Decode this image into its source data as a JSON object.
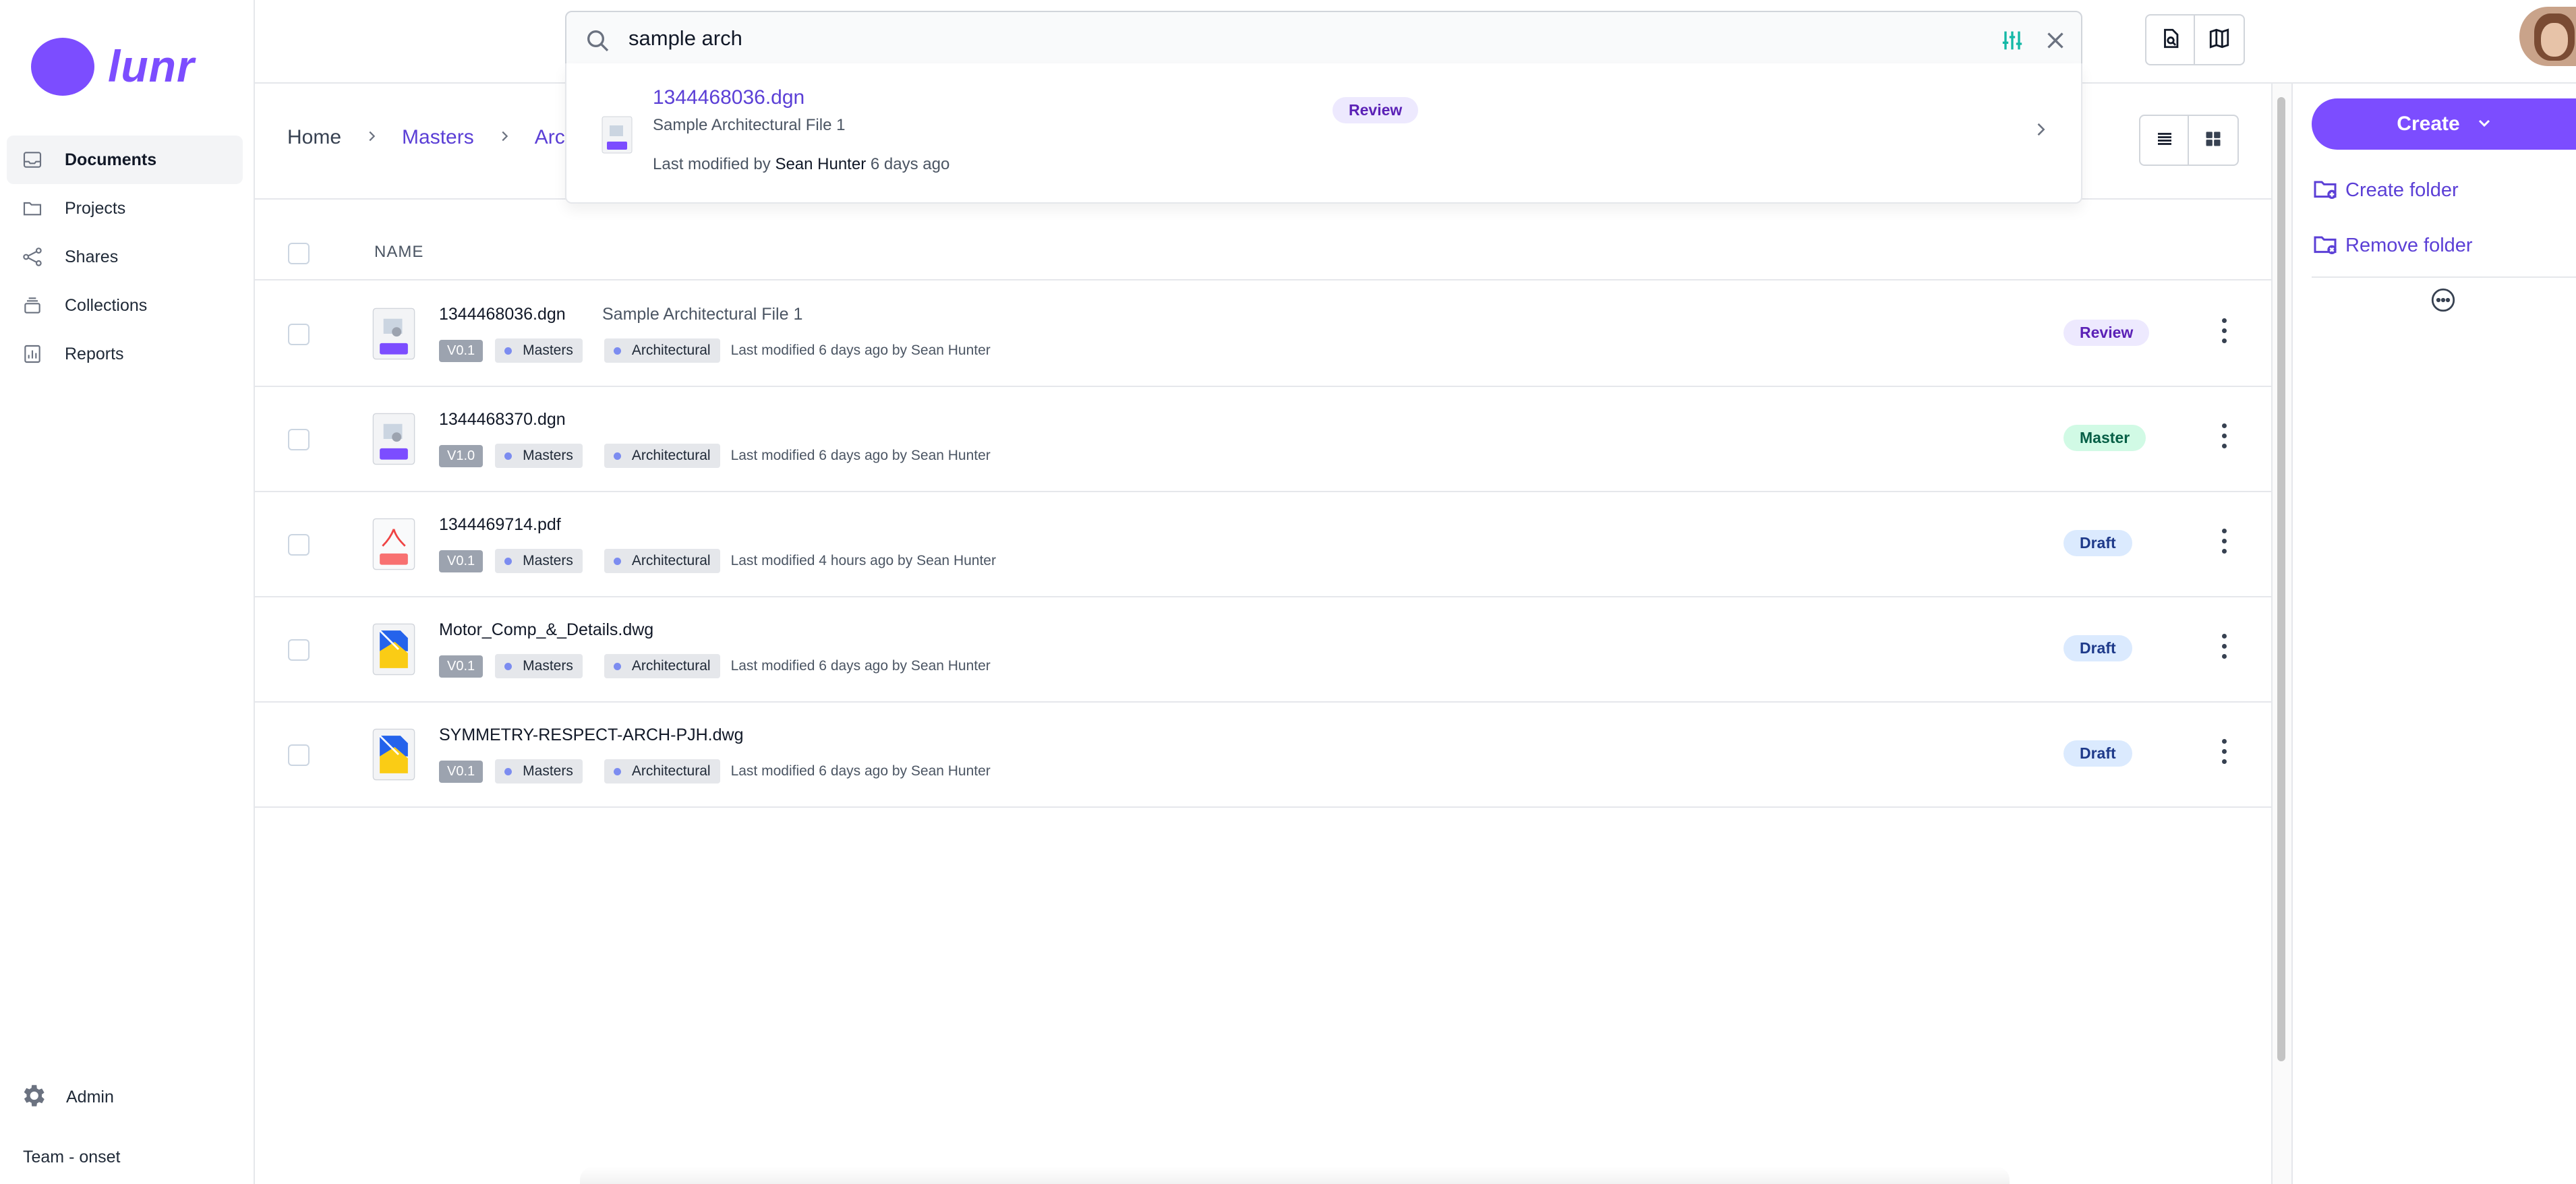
{
  "app": {
    "logo_text": "lunr"
  },
  "sidebar": {
    "items": [
      {
        "label": "Documents",
        "icon": "inbox-icon",
        "active": true
      },
      {
        "label": "Projects",
        "icon": "folder-icon"
      },
      {
        "label": "Shares",
        "icon": "share-icon"
      },
      {
        "label": "Collections",
        "icon": "stack-icon"
      },
      {
        "label": "Reports",
        "icon": "chart-icon"
      }
    ],
    "admin_label": "Admin",
    "team_label": "Team - onset"
  },
  "search": {
    "value": "sample arch",
    "result": {
      "file_name": "1344468036.dgn",
      "title": "Sample Architectural File 1",
      "status": "Review",
      "modified_prefix": "Last modified by",
      "modified_user": "Sean Hunter",
      "modified_when": "6 days ago"
    }
  },
  "breadcrumb": {
    "home": "Home",
    "masters": "Masters",
    "current": "Archit"
  },
  "table": {
    "name_header": "NAME",
    "rows": [
      {
        "file": "1344468036.dgn",
        "desc": "Sample Architectural File 1",
        "version": "V0.1",
        "folder": "Masters",
        "discipline": "Architectural",
        "modified": "Last modified 6 days ago by Sean Hunter",
        "status": "Review",
        "type": "dgn"
      },
      {
        "file": "1344468370.dgn",
        "desc": "",
        "version": "V1.0",
        "folder": "Masters",
        "discipline": "Architectural",
        "modified": "Last modified 6 days ago by Sean Hunter",
        "status": "Master",
        "type": "dgn"
      },
      {
        "file": "1344469714.pdf",
        "desc": "",
        "version": "V0.1",
        "folder": "Masters",
        "discipline": "Architectural",
        "modified": "Last modified 4 hours ago by Sean Hunter",
        "status": "Draft",
        "type": "pdf"
      },
      {
        "file": "Motor_Comp_&_Details.dwg",
        "desc": "",
        "version": "V0.1",
        "folder": "Masters",
        "discipline": "Architectural",
        "modified": "Last modified 6 days ago by Sean Hunter",
        "status": "Draft",
        "type": "dwg"
      },
      {
        "file": "SYMMETRY-RESPECT-ARCH-PJH.dwg",
        "desc": "",
        "version": "V0.1",
        "folder": "Masters",
        "discipline": "Architectural",
        "modified": "Last modified 6 days ago by Sean Hunter",
        "status": "Draft",
        "type": "dwg"
      }
    ]
  },
  "actions": {
    "create_label": "Create",
    "create_folder": "Create folder",
    "remove_folder": "Remove folder"
  },
  "colors": {
    "accent": "#7c4dff",
    "link": "#5b3fd6"
  }
}
